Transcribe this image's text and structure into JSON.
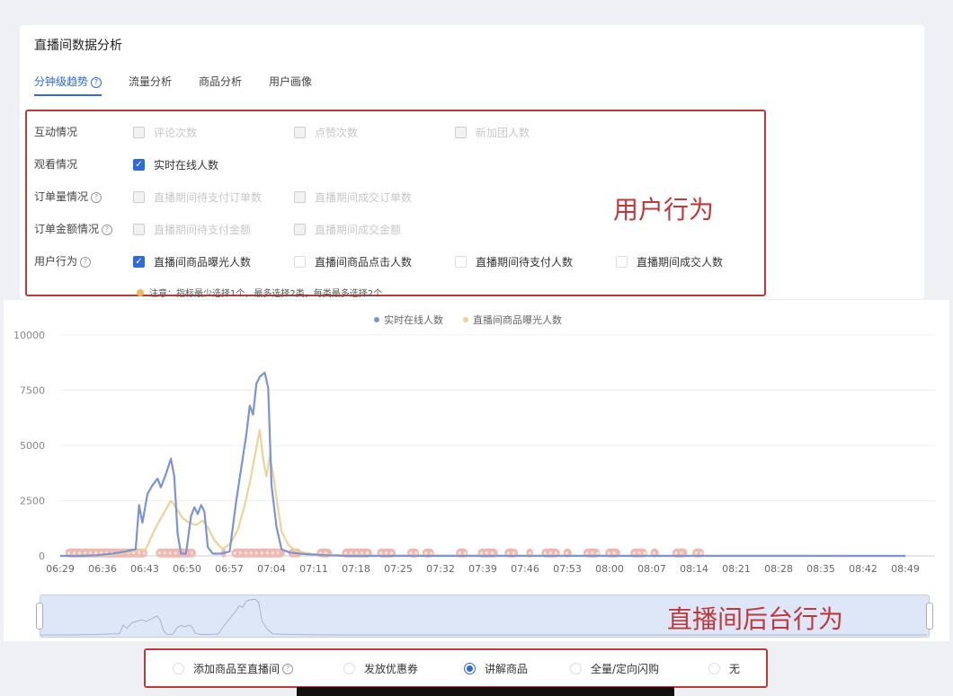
{
  "page_title": "直播间数据分析",
  "tabs": [
    {
      "label": "分钟级趋势",
      "active": true
    },
    {
      "label": "流量分析"
    },
    {
      "label": "商品分析"
    },
    {
      "label": "用户画像"
    }
  ],
  "metric_rows": [
    {
      "label": "互动情况",
      "options": [
        {
          "label": "评论次数",
          "checked": false,
          "disabled": true
        },
        {
          "label": "点赞次数",
          "checked": false,
          "disabled": true
        },
        {
          "label": "新加团人数",
          "checked": false,
          "disabled": true
        }
      ]
    },
    {
      "label": "观看情况",
      "options": [
        {
          "label": "实时在线人数",
          "checked": true,
          "disabled": false
        }
      ]
    },
    {
      "label": "订单量情况",
      "options": [
        {
          "label": "直播期间待支付订单数",
          "checked": false,
          "disabled": true
        },
        {
          "label": "直播期间成交订单数",
          "checked": false,
          "disabled": true
        }
      ]
    },
    {
      "label": "订单金额情况",
      "options": [
        {
          "label": "直播期间待支付金额",
          "checked": false,
          "disabled": true
        },
        {
          "label": "直播期间成交金额",
          "checked": false,
          "disabled": true
        }
      ]
    },
    {
      "label": "用户行为",
      "options": [
        {
          "label": "直播间商品曝光人数",
          "checked": true,
          "disabled": false
        },
        {
          "label": "直播间商品点击人数",
          "checked": false,
          "disabled": false
        },
        {
          "label": "直播期间待支付人数",
          "checked": false,
          "disabled": false
        },
        {
          "label": "直播期间成交人数",
          "checked": false,
          "disabled": false
        }
      ]
    }
  ],
  "note": "注意：指标最少选择1个，最多选择2类，每类最多选择2个",
  "overlay_user_behavior": "用户行为",
  "overlay_backend_behavior": "直播间后台行为",
  "bottom_options": [
    {
      "label": "添加商品至直播间",
      "selected": false
    },
    {
      "label": "发放优惠券",
      "selected": false
    },
    {
      "label": "讲解商品",
      "selected": true
    },
    {
      "label": "全量/定向闪购",
      "selected": false
    },
    {
      "label": "无",
      "selected": false
    }
  ],
  "colors": {
    "accent": "#2c6bd9",
    "series_online": "#7b95d4",
    "series_exposure": "#ecd397",
    "event_marker": "#f0b8b3",
    "annotation_red": "#c0393a"
  },
  "chart_data": {
    "type": "line",
    "ylim": [
      0,
      10000
    ],
    "yticks": [
      "0",
      "2500",
      "5000",
      "7500",
      "10000"
    ],
    "x_tick_labels": [
      "06:29",
      "06:36",
      "06:43",
      "06:50",
      "06:57",
      "07:04",
      "07:11",
      "07:18",
      "07:25",
      "07:32",
      "07:39",
      "07:46",
      "07:53",
      "08:00",
      "08:07",
      "08:14",
      "08:21",
      "08:28",
      "08:35",
      "08:42",
      "08:49"
    ],
    "x_start_min": 389,
    "x_end_min": 893,
    "series": [
      {
        "name": "实时在线人数",
        "points": [
          [
            389,
            0
          ],
          [
            400,
            0
          ],
          [
            410,
            30
          ],
          [
            420,
            100
          ],
          [
            428,
            200
          ],
          [
            434,
            300
          ],
          [
            436,
            2300
          ],
          [
            438,
            1500
          ],
          [
            441,
            2800
          ],
          [
            444,
            3200
          ],
          [
            447,
            3500
          ],
          [
            449,
            3100
          ],
          [
            452,
            3700
          ],
          [
            455,
            4400
          ],
          [
            457,
            3600
          ],
          [
            459,
            1000
          ],
          [
            461,
            100
          ],
          [
            464,
            100
          ],
          [
            467,
            1800
          ],
          [
            469,
            2200
          ],
          [
            471,
            1900
          ],
          [
            473,
            2300
          ],
          [
            475,
            2000
          ],
          [
            477,
            400
          ],
          [
            480,
            100
          ],
          [
            485,
            100
          ],
          [
            490,
            200
          ],
          [
            494,
            2500
          ],
          [
            497,
            4000
          ],
          [
            500,
            5500
          ],
          [
            502,
            6800
          ],
          [
            504,
            6400
          ],
          [
            506,
            7800
          ],
          [
            508,
            8100
          ],
          [
            511,
            8300
          ],
          [
            513,
            7600
          ],
          [
            515,
            3200
          ],
          [
            518,
            1300
          ],
          [
            521,
            300
          ],
          [
            526,
            150
          ],
          [
            535,
            80
          ],
          [
            548,
            30
          ],
          [
            560,
            0
          ],
          [
            893,
            0
          ]
        ]
      },
      {
        "name": "直播间商品曝光人数",
        "points": [
          [
            389,
            0
          ],
          [
            420,
            50
          ],
          [
            440,
            300
          ],
          [
            446,
            1300
          ],
          [
            452,
            2100
          ],
          [
            455,
            2500
          ],
          [
            458,
            2200
          ],
          [
            462,
            1700
          ],
          [
            466,
            1500
          ],
          [
            470,
            1400
          ],
          [
            474,
            1600
          ],
          [
            477,
            1300
          ],
          [
            481,
            700
          ],
          [
            486,
            300
          ],
          [
            491,
            600
          ],
          [
            495,
            1200
          ],
          [
            499,
            2300
          ],
          [
            502,
            3300
          ],
          [
            506,
            4900
          ],
          [
            508,
            5700
          ],
          [
            510,
            4400
          ],
          [
            512,
            3600
          ],
          [
            514,
            4500
          ],
          [
            516,
            3700
          ],
          [
            518,
            2600
          ],
          [
            521,
            1100
          ],
          [
            525,
            500
          ],
          [
            530,
            200
          ],
          [
            540,
            80
          ],
          [
            560,
            20
          ],
          [
            893,
            0
          ]
        ]
      }
    ],
    "event_segments": [
      [
        392,
        441
      ],
      [
        446,
        470
      ],
      [
        485,
        488
      ],
      [
        491,
        523
      ],
      [
        525,
        533
      ],
      [
        542,
        551
      ],
      [
        557,
        575
      ],
      [
        578,
        589
      ],
      [
        596,
        603
      ],
      [
        605,
        612
      ],
      [
        625,
        632
      ],
      [
        638,
        650
      ],
      [
        654,
        662
      ],
      [
        667,
        671
      ],
      [
        676,
        687
      ],
      [
        689,
        694
      ],
      [
        701,
        711
      ],
      [
        714,
        723
      ],
      [
        729,
        739
      ],
      [
        741,
        746
      ],
      [
        754,
        763
      ],
      [
        766,
        773
      ]
    ]
  }
}
